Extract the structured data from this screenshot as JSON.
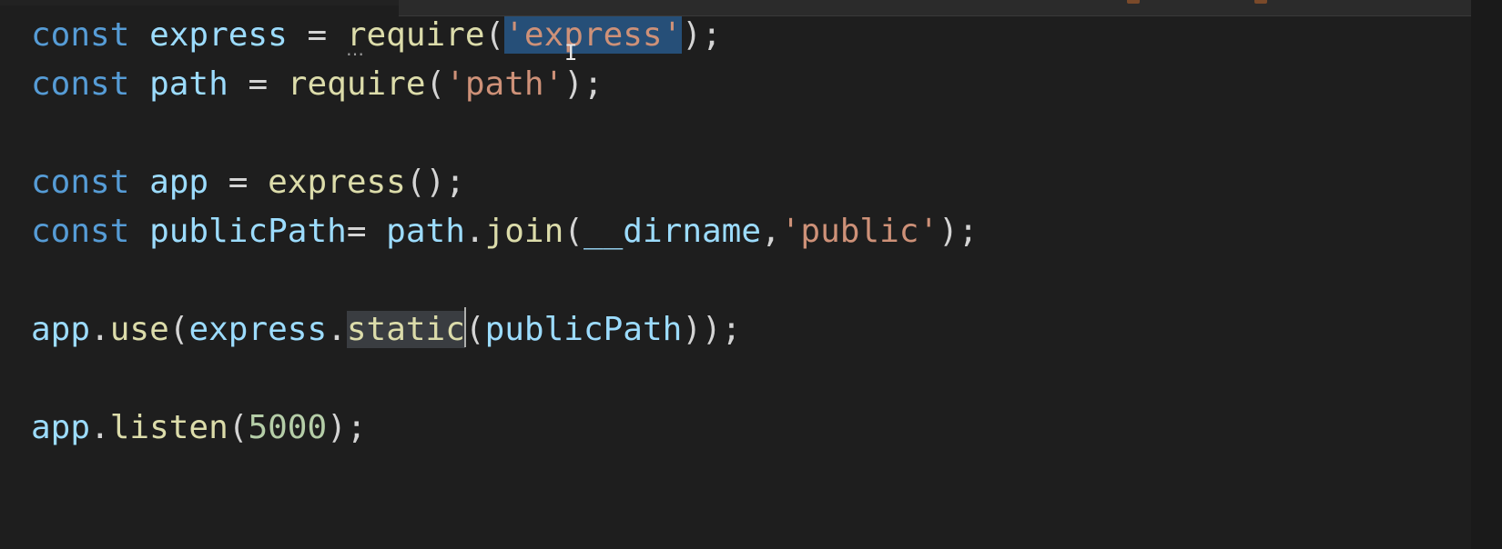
{
  "editor": {
    "colors": {
      "background": "#1e1e1e",
      "keyword": "#569cd6",
      "variable": "#9cdcfe",
      "function": "#dcdcaa",
      "string": "#ce9178",
      "number": "#b5cea8",
      "punctuation": "#d4d4d4"
    },
    "lines": [
      [
        {
          "t": "keyword",
          "v": "const"
        },
        {
          "t": "punc",
          "v": " "
        },
        {
          "t": "var",
          "v": "express"
        },
        {
          "t": "punc",
          "v": " = "
        },
        {
          "t": "func",
          "v": "require"
        },
        {
          "t": "punc",
          "v": "("
        },
        {
          "t": "string",
          "v": "'express'",
          "hl": "string"
        },
        {
          "t": "punc",
          "v": ");"
        }
      ],
      [
        {
          "t": "keyword",
          "v": "const"
        },
        {
          "t": "punc",
          "v": " "
        },
        {
          "t": "var",
          "v": "path"
        },
        {
          "t": "punc",
          "v": " = "
        },
        {
          "t": "func",
          "v": "require"
        },
        {
          "t": "punc",
          "v": "("
        },
        {
          "t": "string",
          "v": "'path'"
        },
        {
          "t": "punc",
          "v": ");"
        }
      ],
      [],
      [
        {
          "t": "keyword",
          "v": "const"
        },
        {
          "t": "punc",
          "v": " "
        },
        {
          "t": "var",
          "v": "app"
        },
        {
          "t": "punc",
          "v": " = "
        },
        {
          "t": "func",
          "v": "express"
        },
        {
          "t": "punc",
          "v": "();"
        }
      ],
      [
        {
          "t": "keyword",
          "v": "const"
        },
        {
          "t": "punc",
          "v": " "
        },
        {
          "t": "var",
          "v": "publicPath"
        },
        {
          "t": "punc",
          "v": "= "
        },
        {
          "t": "var",
          "v": "path"
        },
        {
          "t": "punc",
          "v": "."
        },
        {
          "t": "func",
          "v": "join"
        },
        {
          "t": "punc",
          "v": "("
        },
        {
          "t": "var",
          "v": "__dirname"
        },
        {
          "t": "punc",
          "v": ","
        },
        {
          "t": "string",
          "v": "'public'"
        },
        {
          "t": "punc",
          "v": ");"
        }
      ],
      [],
      [
        {
          "t": "var",
          "v": "app"
        },
        {
          "t": "punc",
          "v": "."
        },
        {
          "t": "func",
          "v": "use"
        },
        {
          "t": "punc",
          "v": "("
        },
        {
          "t": "var",
          "v": "express"
        },
        {
          "t": "punc",
          "v": "."
        },
        {
          "t": "func",
          "v": "static",
          "hl": "word"
        },
        {
          "t": "cursor",
          "v": ""
        },
        {
          "t": "punc",
          "v": "("
        },
        {
          "t": "var",
          "v": "publicPath"
        },
        {
          "t": "punc",
          "v": "));"
        }
      ],
      [],
      [
        {
          "t": "var",
          "v": "app"
        },
        {
          "t": "punc",
          "v": "."
        },
        {
          "t": "func",
          "v": "listen"
        },
        {
          "t": "punc",
          "v": "("
        },
        {
          "t": "number",
          "v": "5000"
        },
        {
          "t": "punc",
          "v": ");"
        }
      ]
    ]
  }
}
